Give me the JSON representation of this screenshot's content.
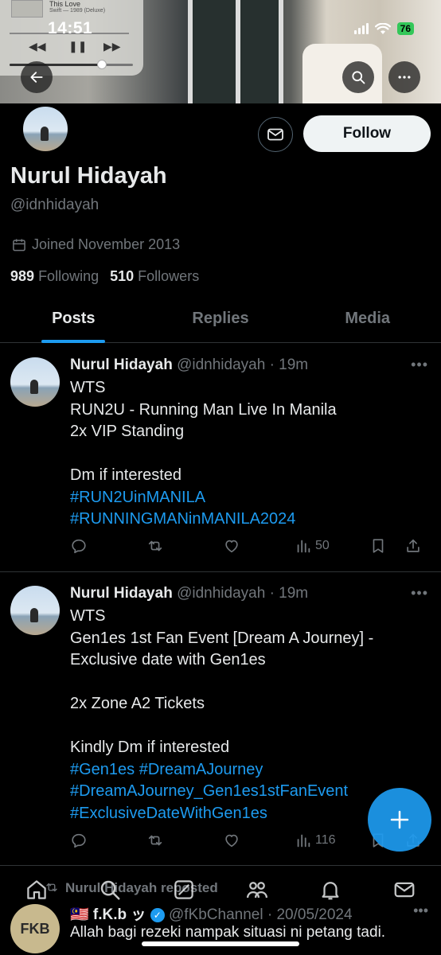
{
  "status_bar": {
    "time": "14:51",
    "battery": "76"
  },
  "now_playing": {
    "title": "This Love",
    "artist": "Swift — 1989 (Deluxe)"
  },
  "header_buttons": {
    "back": "back-arrow-icon",
    "search": "search-icon",
    "more": "more-icon"
  },
  "profile": {
    "name": "Nurul Hidayah",
    "handle": "@idnhidayah",
    "joined": "Joined November 2013",
    "following_count": "989",
    "following_label": "Following",
    "followers_count": "510",
    "followers_label": "Followers",
    "follow_button": "Follow"
  },
  "tabs": [
    {
      "label": "Posts",
      "active": true
    },
    {
      "label": "Replies",
      "active": false
    },
    {
      "label": "Media",
      "active": false
    }
  ],
  "posts": [
    {
      "name": "Nurul Hidayah",
      "meta": "@idnhidayah · 19m",
      "lines": [
        "WTS",
        "RUN2U - Running Man Live In Manila",
        "2x VIP Standing",
        "",
        "Dm if interested"
      ],
      "tags": [
        "#RUN2UinMANILA",
        "#RUNNINGMANinMANILA2024"
      ],
      "views": "50"
    },
    {
      "name": "Nurul Hidayah",
      "meta": "@idnhidayah · 19m",
      "lines": [
        "WTS",
        "Gen1es 1st Fan Event [Dream A Journey] -",
        "Exclusive date with Gen1es",
        "",
        "2x Zone A2 Tickets",
        "",
        "Kindly Dm if interested"
      ],
      "tags": [
        "#Gen1es #DreamAJourney",
        "#DreamAJourney_Gen1es1stFanEvent",
        "#ExclusiveDateWithGen1es"
      ],
      "views": "116"
    }
  ],
  "repost": {
    "reposted_label": "Nurul Hidayah reposted",
    "name": "🇲🇾 f.K.b ッ",
    "meta": "@fKbChannel · 20/05/2024",
    "text": "Allah bagi rezeki nampak situasi ni petang tadi.",
    "avatar_text": "FKB"
  },
  "colors": {
    "accent": "#1d9bf0",
    "secondary_text": "#71767b",
    "background": "#000000"
  }
}
